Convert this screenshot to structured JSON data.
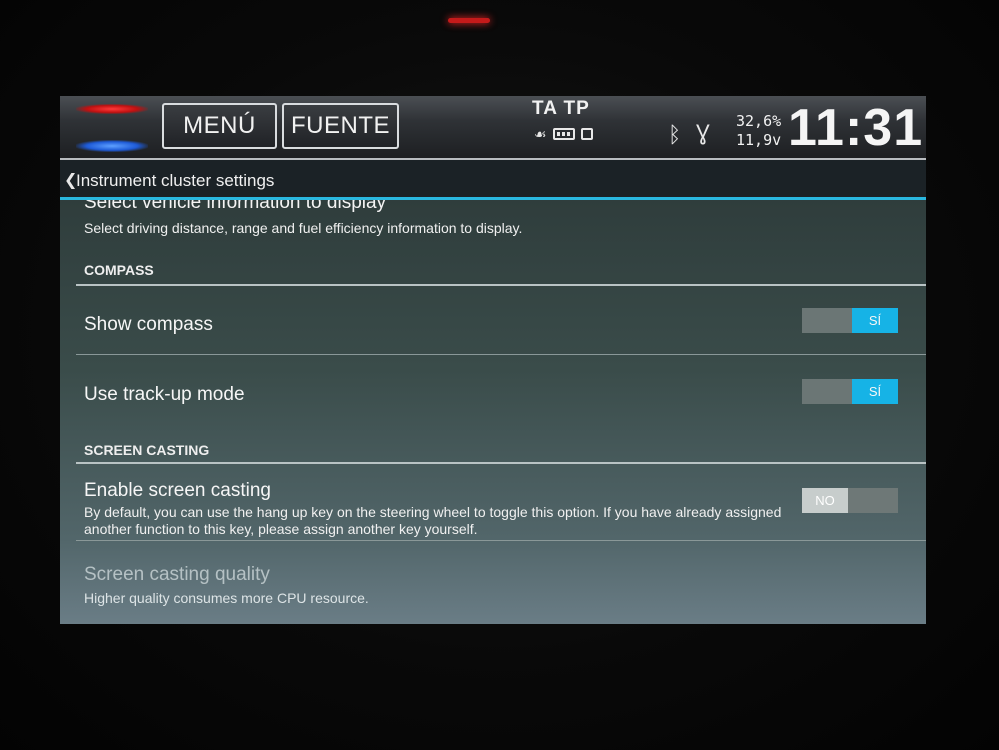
{
  "statusbar": {
    "menu_label": "MENÚ",
    "source_label": "FUENTE",
    "ta_tp": "TA TP",
    "humidity": "32,6%",
    "voltage": "11,9v",
    "time": "11:31"
  },
  "header": {
    "back_glyph": "❮",
    "title": "Instrument cluster settings"
  },
  "content": {
    "clipped_item": {
      "title": "Select vehicle information to display",
      "description": "Select driving distance, range and fuel efficiency information to display."
    },
    "compass_section": "COMPASS",
    "show_compass": {
      "label": "Show compass",
      "state": "on",
      "toggle_text": "SÍ"
    },
    "track_up": {
      "label": "Use track-up mode",
      "state": "on",
      "toggle_text": "SÍ"
    },
    "screen_casting_section": "SCREEN CASTING",
    "enable_casting": {
      "label": "Enable screen casting",
      "description": "By default, you can use the hang up key on the steering wheel to toggle this option. If you have already assigned another function to this key, please assign another key yourself.",
      "state": "off",
      "toggle_text": "NO"
    },
    "casting_quality": {
      "label": "Screen casting quality",
      "description": "Higher quality consumes more CPU resource."
    }
  },
  "colors": {
    "accent": "#16b3e6",
    "header_line": "#2ab8e0"
  }
}
